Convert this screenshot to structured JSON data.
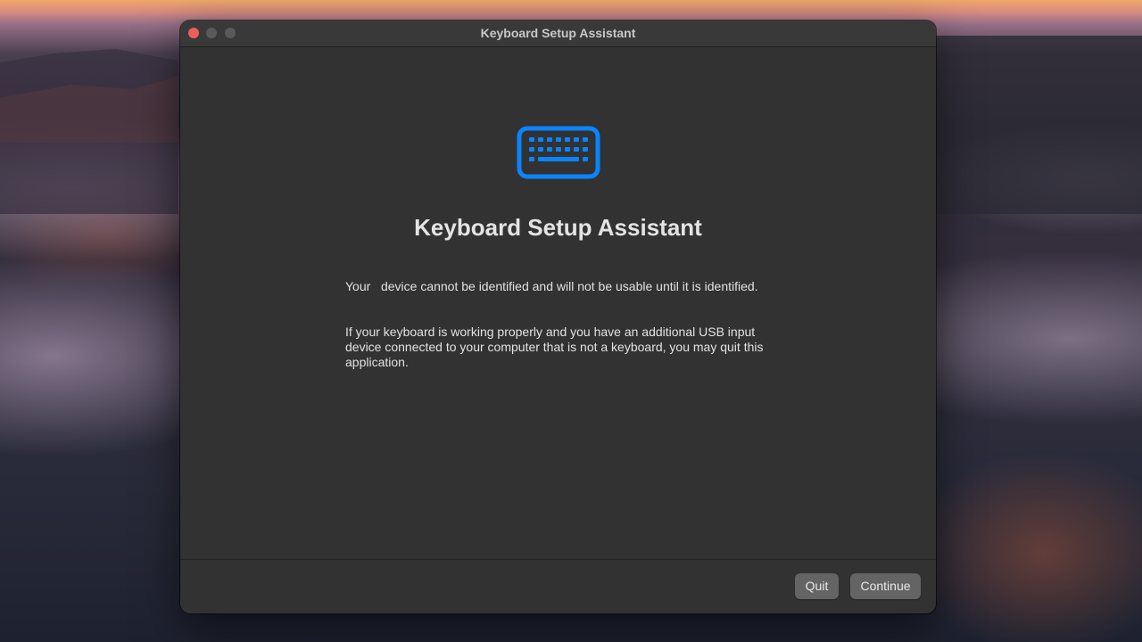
{
  "window": {
    "title": "Keyboard Setup Assistant"
  },
  "content": {
    "icon": "keyboard-icon",
    "heading": "Keyboard Setup Assistant",
    "message_1": "Your   device cannot be identified and will not be usable until it is identified.",
    "message_2": "If your keyboard is working properly and you have an additional USB input device connected to your computer that is not a keyboard, you may quit this application."
  },
  "footer": {
    "quit_label": "Quit",
    "continue_label": "Continue"
  },
  "colors": {
    "accent": "#0a84ff",
    "close": "#ee5e57",
    "window_bg": "#323232",
    "button_bg": "#646464"
  }
}
